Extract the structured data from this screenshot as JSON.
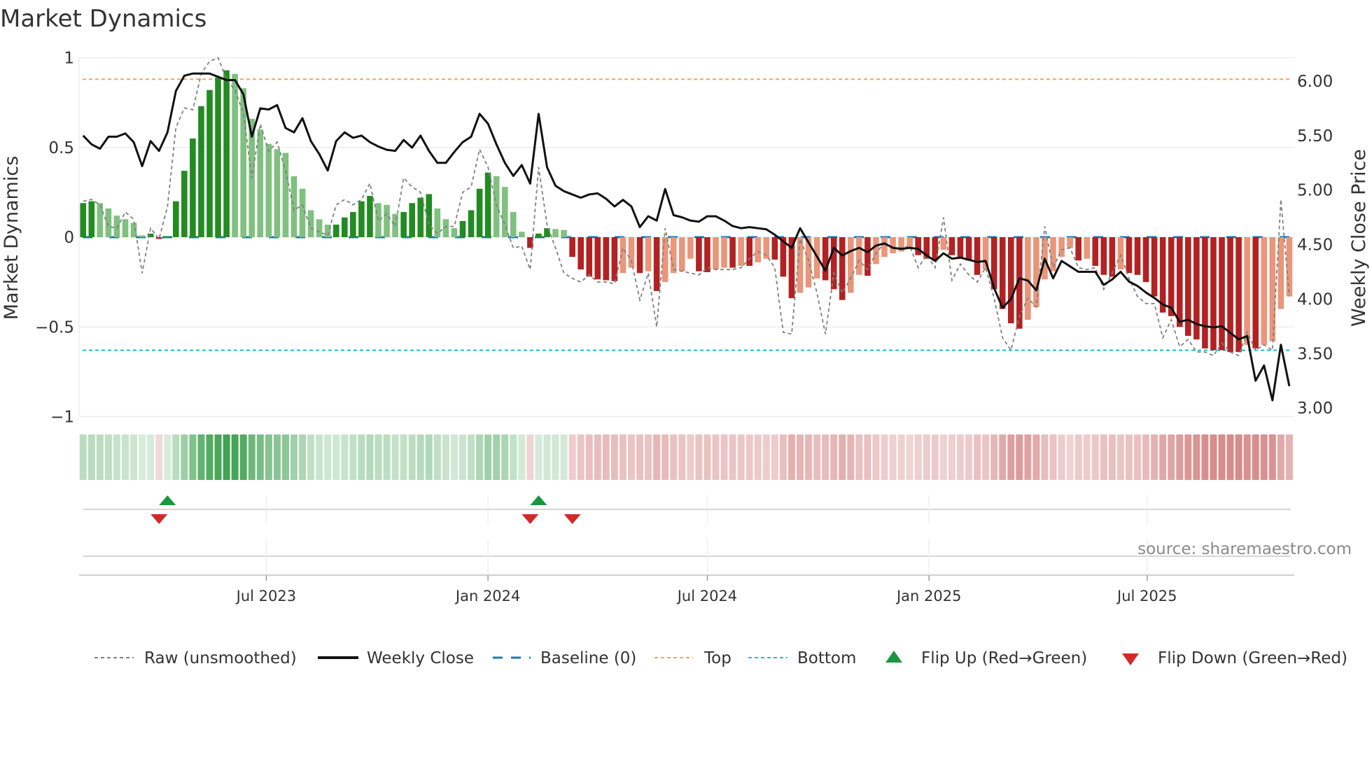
{
  "title": "Market Dynamics",
  "source": "source: sharemaestro.com",
  "chart_data": {
    "type": "bar",
    "title": "Market Dynamics",
    "start_date": "2023-01-30",
    "frequency": "weekly",
    "ylabel": "Market Dynamics",
    "y2label": "Weekly Close Price",
    "ylim": [
      -1,
      1
    ],
    "y2lim": [
      2.92,
      6.21
    ],
    "yticks": [
      {
        "v": 1,
        "label": "1"
      },
      {
        "v": 0.5,
        "label": "0.5"
      },
      {
        "v": 0,
        "label": "0"
      },
      {
        "v": -0.5,
        "label": "−0.5"
      },
      {
        "v": -1,
        "label": "−1"
      }
    ],
    "y2ticks": [
      {
        "v": 6,
        "label": "6.00"
      },
      {
        "v": 5.5,
        "label": "5.50"
      },
      {
        "v": 5,
        "label": "5.00"
      },
      {
        "v": 4.5,
        "label": "4.50"
      },
      {
        "v": 4,
        "label": "4.00"
      },
      {
        "v": 3.5,
        "label": "3.50"
      },
      {
        "v": 3,
        "label": "3.00"
      }
    ],
    "xticks": [
      {
        "date": "2023-07-01",
        "label": "Jul 2023"
      },
      {
        "date": "2024-01-01",
        "label": "Jan 2024"
      },
      {
        "date": "2024-07-01",
        "label": "Jul 2024"
      },
      {
        "date": "2025-01-01",
        "label": "Jan 2025"
      },
      {
        "date": "2025-07-01",
        "label": "Jul 2025"
      }
    ],
    "top_level": 0.88,
    "bottom_level": -0.63,
    "baseline": 0,
    "dynamics": [
      0.19,
      0.2,
      0.19,
      0.16,
      0.12,
      0.1,
      0.08,
      0.01,
      0.02,
      -0.01,
      0.005,
      0.2,
      0.37,
      0.55,
      0.73,
      0.82,
      0.89,
      0.93,
      0.91,
      0.83,
      0.66,
      0.6,
      0.52,
      0.49,
      0.47,
      0.34,
      0.27,
      0.15,
      0.1,
      0.07,
      0.07,
      0.11,
      0.14,
      0.2,
      0.23,
      0.19,
      0.18,
      0.13,
      0.14,
      0.19,
      0.22,
      0.24,
      0.16,
      0.1,
      0.05,
      0.09,
      0.15,
      0.27,
      0.36,
      0.34,
      0.28,
      0.14,
      0.03,
      -0.06,
      0.02,
      0.05,
      0.045,
      0.04,
      -0.11,
      -0.18,
      -0.22,
      -0.235,
      -0.24,
      -0.245,
      -0.2,
      -0.17,
      -0.2,
      -0.19,
      -0.3,
      -0.25,
      -0.2,
      -0.19,
      -0.12,
      -0.19,
      -0.195,
      -0.18,
      -0.17,
      -0.17,
      -0.16,
      -0.16,
      -0.14,
      -0.12,
      -0.125,
      -0.22,
      -0.34,
      -0.31,
      -0.28,
      -0.23,
      -0.24,
      -0.29,
      -0.35,
      -0.31,
      -0.21,
      -0.215,
      -0.15,
      -0.11,
      -0.09,
      -0.08,
      -0.06,
      -0.1,
      -0.12,
      -0.13,
      -0.07,
      -0.1,
      -0.12,
      -0.13,
      -0.21,
      -0.18,
      -0.29,
      -0.4,
      -0.48,
      -0.51,
      -0.46,
      -0.39,
      -0.235,
      -0.19,
      -0.11,
      -0.06,
      -0.13,
      -0.12,
      -0.16,
      -0.21,
      -0.22,
      -0.18,
      -0.2,
      -0.21,
      -0.25,
      -0.33,
      -0.42,
      -0.44,
      -0.5,
      -0.55,
      -0.57,
      -0.62,
      -0.63,
      -0.63,
      -0.64,
      -0.64,
      -0.6,
      -0.62,
      -0.6,
      -0.58,
      -0.4,
      -0.33
    ],
    "raw": [
      0.2,
      0.21,
      0.18,
      0.06,
      0.05,
      0.14,
      0.1,
      -0.2,
      0.05,
      -0.01,
      0.17,
      0.61,
      0.72,
      0.71,
      0.91,
      0.98,
      1.0,
      0.88,
      0.82,
      0.69,
      0.33,
      0.63,
      0.48,
      0.53,
      0.37,
      0.15,
      0.18,
      0.05,
      0.03,
      0.01,
      0.18,
      0.21,
      0.18,
      0.21,
      0.3,
      0.09,
      0.13,
      0.06,
      0.33,
      0.28,
      0.25,
      0.07,
      0.02,
      0.06,
      0.06,
      0.25,
      0.28,
      0.49,
      0.39,
      0.18,
      0.07,
      -0.06,
      -0.05,
      -0.18,
      0.39,
      0.07,
      -0.06,
      -0.2,
      -0.23,
      -0.25,
      -0.21,
      -0.25,
      -0.25,
      -0.26,
      -0.06,
      -0.13,
      -0.35,
      -0.2,
      -0.5,
      0.05,
      -0.18,
      -0.19,
      -0.2,
      -0.21,
      -0.17,
      -0.18,
      -0.18,
      -0.18,
      -0.17,
      -0.12,
      -0.08,
      -0.1,
      -0.17,
      -0.53,
      -0.54,
      -0.01,
      -0.13,
      -0.31,
      -0.54,
      -0.2,
      -0.31,
      -0.23,
      -0.13,
      -0.18,
      -0.09,
      -0.03,
      -0.06,
      -0.06,
      -0.05,
      -0.17,
      -0.1,
      -0.17,
      0.11,
      -0.24,
      -0.15,
      -0.21,
      -0.25,
      -0.17,
      -0.34,
      -0.56,
      -0.63,
      -0.44,
      -0.34,
      -0.39,
      0.06,
      -0.17,
      -0.07,
      -0.06,
      -0.17,
      -0.18,
      -0.17,
      -0.29,
      -0.2,
      -0.1,
      -0.23,
      -0.33,
      -0.37,
      -0.37,
      -0.56,
      -0.46,
      -0.61,
      -0.57,
      -0.64,
      -0.64,
      -0.66,
      -0.59,
      -0.64,
      -0.66,
      -0.53,
      -0.63,
      -0.6,
      -0.63,
      0.21,
      -0.33
    ],
    "weekly_close": [
      5.5,
      5.42,
      5.38,
      5.49,
      5.49,
      5.52,
      5.44,
      5.22,
      5.45,
      5.36,
      5.53,
      5.91,
      6.05,
      6.07,
      6.07,
      6.07,
      6.04,
      6.01,
      6.01,
      5.88,
      5.49,
      5.75,
      5.74,
      5.78,
      5.57,
      5.53,
      5.66,
      5.45,
      5.33,
      5.18,
      5.45,
      5.53,
      5.48,
      5.5,
      5.44,
      5.4,
      5.37,
      5.36,
      5.46,
      5.39,
      5.5,
      5.36,
      5.25,
      5.25,
      5.35,
      5.44,
      5.49,
      5.7,
      5.61,
      5.42,
      5.25,
      5.13,
      5.23,
      5.06,
      5.7,
      5.21,
      5.04,
      4.99,
      4.96,
      4.93,
      4.96,
      4.97,
      4.92,
      4.85,
      4.91,
      4.85,
      4.66,
      4.76,
      4.72,
      5.01,
      4.77,
      4.75,
      4.72,
      4.71,
      4.76,
      4.76,
      4.72,
      4.67,
      4.65,
      4.66,
      4.65,
      4.64,
      4.59,
      4.53,
      4.47,
      4.65,
      4.52,
      4.39,
      4.26,
      4.47,
      4.4,
      4.44,
      4.47,
      4.43,
      4.49,
      4.51,
      4.47,
      4.46,
      4.47,
      4.46,
      4.4,
      4.35,
      4.42,
      4.37,
      4.38,
      4.36,
      4.34,
      4.35,
      4.1,
      3.92,
      4.0,
      4.19,
      4.17,
      4.08,
      4.37,
      4.19,
      4.35,
      4.3,
      4.25,
      4.25,
      4.25,
      4.13,
      4.18,
      4.25,
      4.16,
      4.12,
      4.06,
      4.01,
      3.95,
      3.92,
      3.79,
      3.81,
      3.77,
      3.75,
      3.74,
      3.75,
      3.69,
      3.63,
      3.66,
      3.25,
      3.39,
      3.07,
      3.58,
      3.2
    ],
    "legend": {
      "raw": "Raw (unsmoothed)",
      "close": "Weekly Close",
      "baseline": "Baseline (0)",
      "top": "Top",
      "bottom": "Bottom",
      "flip_up": "Flip Up (Red→Green)",
      "flip_down": "Flip Down (Green→Red)"
    },
    "legend_placement": "bottom",
    "colors": {
      "green_strong": "#228b22",
      "green_weak": "#80c080",
      "red_strong": "#b22222",
      "red_weak": "#e9967a",
      "raw": "#808080",
      "close": "#111111",
      "baseline": "#1f77b4",
      "top": "#f4a460",
      "bottom": "#17becf",
      "flip_up": "#1a9641",
      "flip_down": "#d62728"
    }
  }
}
